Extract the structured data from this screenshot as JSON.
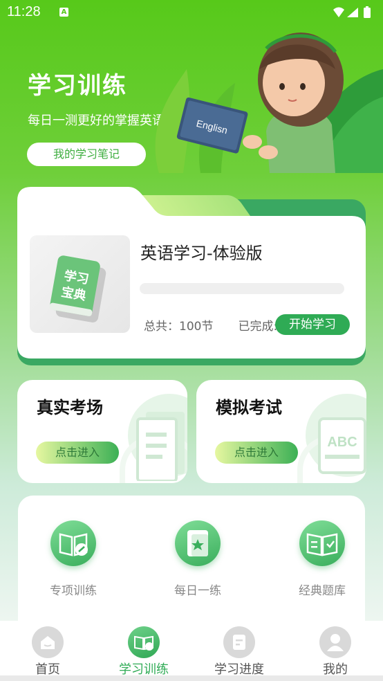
{
  "status_bar": {
    "time": "11:28",
    "notification_icon": "A"
  },
  "hero": {
    "title": "学习训练",
    "subtitle": "每日一测更好的掌握英语知识",
    "notes_button": "我的学习笔记",
    "book_text": "Englisn"
  },
  "course": {
    "title": "英语学习-体验版",
    "cover_text_line1": "学习",
    "cover_text_line2": "宝典",
    "total": "总共：100节",
    "completed": "已完成:",
    "start_button": "开始学习",
    "progress": 0
  },
  "exams": [
    {
      "title": "真实考场",
      "enter": "点击进入",
      "badge": ""
    },
    {
      "title": "模拟考试",
      "enter": "点击进入",
      "badge": "ABC"
    }
  ],
  "tools": [
    {
      "label": "专项训练",
      "icon": "book-check-icon"
    },
    {
      "label": "每日一练",
      "icon": "star-book-icon"
    },
    {
      "label": "经典题库",
      "icon": "open-book-icon"
    }
  ],
  "tabbar": [
    {
      "label": "首页",
      "icon": "home-icon",
      "active": false
    },
    {
      "label": "学习训练",
      "icon": "study-icon",
      "active": true
    },
    {
      "label": "学习进度",
      "icon": "progress-icon",
      "active": false
    },
    {
      "label": "我的",
      "icon": "user-icon",
      "active": false
    }
  ],
  "colors": {
    "primary": "#2fab55",
    "header_green": "#57c91a"
  }
}
